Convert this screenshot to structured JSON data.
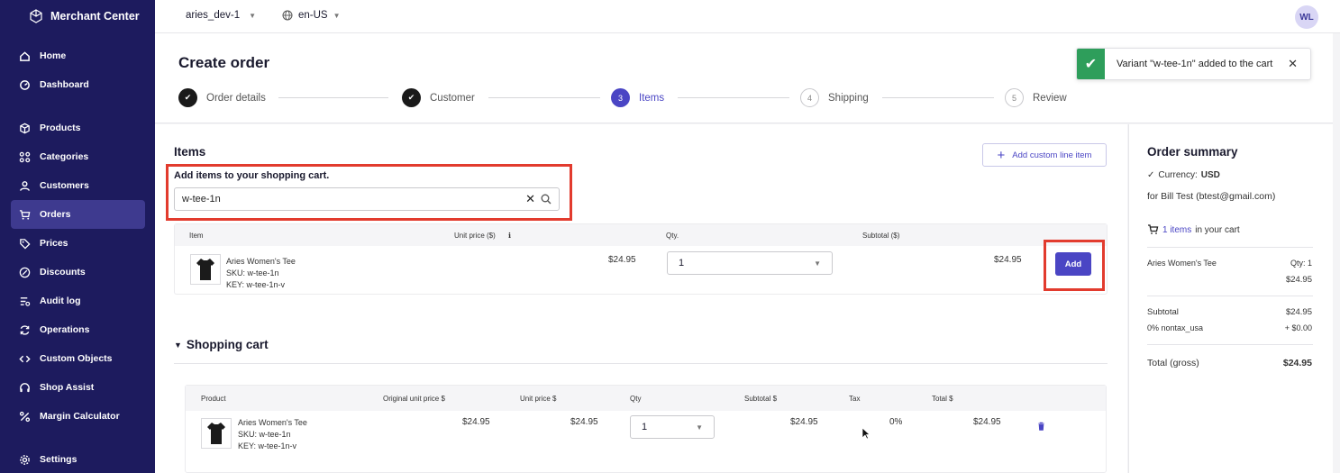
{
  "app": {
    "name": "Merchant Center"
  },
  "sidebar": {
    "items": [
      {
        "label": "Home",
        "icon": "home-icon",
        "active": false
      },
      {
        "label": "Dashboard",
        "icon": "gauge-icon",
        "active": false
      },
      {
        "label": "Products",
        "icon": "box-icon",
        "active": false
      },
      {
        "label": "Categories",
        "icon": "categories-icon",
        "active": false
      },
      {
        "label": "Customers",
        "icon": "user-icon",
        "active": false
      },
      {
        "label": "Orders",
        "icon": "cart-icon",
        "active": true
      },
      {
        "label": "Prices",
        "icon": "prices-icon",
        "active": false
      },
      {
        "label": "Discounts",
        "icon": "discount-icon",
        "active": false
      },
      {
        "label": "Audit log",
        "icon": "audit-icon",
        "active": false
      },
      {
        "label": "Operations",
        "icon": "operations-icon",
        "active": false
      },
      {
        "label": "Custom Objects",
        "icon": "code-icon",
        "active": false
      },
      {
        "label": "Shop Assist",
        "icon": "headset-icon",
        "active": false
      },
      {
        "label": "Margin Calculator",
        "icon": "percent-icon",
        "active": false
      },
      {
        "label": "Settings",
        "icon": "gear-icon",
        "active": false
      }
    ]
  },
  "topbar": {
    "project": "aries_dev-1",
    "locale": "en-US",
    "avatar": "WL"
  },
  "header": {
    "title": "Create order",
    "steps": [
      {
        "num": "1",
        "label": "Order details",
        "state": "done"
      },
      {
        "num": "2",
        "label": "Customer",
        "state": "done"
      },
      {
        "num": "3",
        "label": "Items",
        "state": "current"
      },
      {
        "num": "4",
        "label": "Shipping",
        "state": "todo"
      },
      {
        "num": "5",
        "label": "Review",
        "state": "todo"
      }
    ]
  },
  "toast": {
    "message": "Variant \"w-tee-1n\" added to the cart",
    "close": "✕"
  },
  "items": {
    "heading": "Items",
    "custom_button": "Add custom line item",
    "add_label": "Add items to your shopping cart.",
    "search_value": "w-tee-1n",
    "columns": {
      "item": "Item",
      "unit_price": "Unit price ($)",
      "qty": "Qty.",
      "subtotal": "Subtotal ($)"
    },
    "result": {
      "name": "Aries Women's Tee",
      "sku": "SKU: w-tee-1n",
      "key": "KEY: w-tee-1n-v",
      "unit_price": "$24.95",
      "qty": "1",
      "subtotal": "$24.95",
      "add_label": "Add"
    }
  },
  "cart": {
    "heading": "Shopping cart",
    "columns": {
      "product": "Product",
      "original": "Original unit price $",
      "unit": "Unit price $",
      "qty": "Qty",
      "subtotal": "Subtotal $",
      "tax": "Tax",
      "total": "Total $"
    },
    "row": {
      "name": "Aries Women's Tee",
      "sku": "SKU: w-tee-1n",
      "key": "KEY: w-tee-1n-v",
      "original": "$24.95",
      "unit": "$24.95",
      "qty": "1",
      "subtotal": "$24.95",
      "tax": "0%",
      "total": "$24.95"
    }
  },
  "summary": {
    "title": "Order summary",
    "currency_label": "Currency:",
    "currency": "USD",
    "customer": "for Bill Test (btest@gmail.com)",
    "items_link": "1 items",
    "items_suffix": "in your cart",
    "line_name": "Aries Women's Tee",
    "line_qty": "Qty: 1",
    "line_price": "$24.95",
    "subtotal_label": "Subtotal",
    "subtotal": "$24.95",
    "tax_label": "0% nontax_usa",
    "tax": "+ $0.00",
    "total_label": "Total (gross)",
    "total": "$24.95"
  },
  "colors": {
    "sidebar": "#1d1b5e",
    "accent": "#4a45c4",
    "success": "#2e9e5b",
    "highlight": "#e23b2e"
  }
}
